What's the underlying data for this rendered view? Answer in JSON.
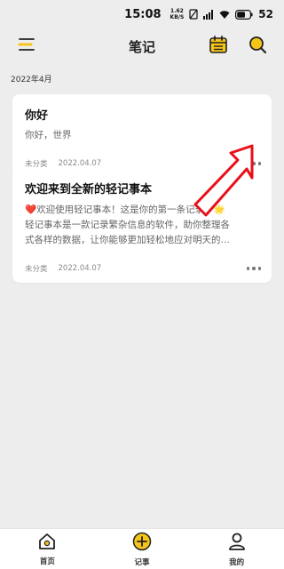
{
  "status_bar": {
    "time": "15:08",
    "net_speed_value": "1.62",
    "net_speed_unit": "KB/S",
    "battery": "52"
  },
  "header": {
    "title": "笔记",
    "menu_icon": "menu-icon",
    "calendar_icon": "calendar-icon",
    "search_icon": "search-icon"
  },
  "month_label": "2022年4月",
  "notes": [
    {
      "title": "你好",
      "body_lines": [
        "你好，世界"
      ],
      "category": "未分类",
      "date": "2022.04.07"
    },
    {
      "title": "欢迎来到全新的轻记事本",
      "body_lines": [
        "❤️欢迎使用轻记事本！这是你的第一条记录。🌟",
        "轻记事本是一款记录繁杂信息的软件，助你整理各",
        "式各样的数据，让你能够更加轻松地应对明天的…"
      ],
      "category": "未分类",
      "date": "2022.04.07"
    }
  ],
  "bottom_nav": [
    {
      "label": "首页",
      "icon": "home-icon"
    },
    {
      "label": "记事",
      "icon": "add-icon"
    },
    {
      "label": "我的",
      "icon": "profile-icon"
    }
  ],
  "colors": {
    "accent": "#f5c518",
    "arrow": "#e8101a",
    "background": "#ededed"
  }
}
